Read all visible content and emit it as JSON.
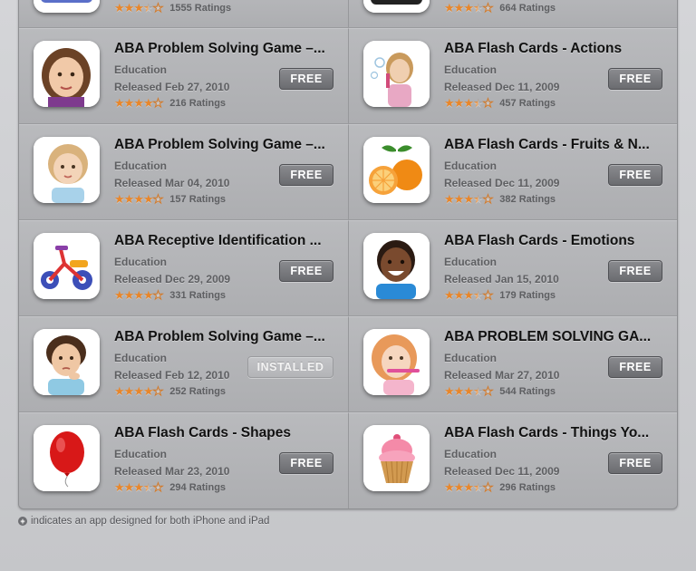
{
  "apps": [
    {
      "title": "",
      "category": "",
      "released": "",
      "ratings": "1555 Ratings",
      "stars": 3.5,
      "button": "",
      "icon": "partial-icon"
    },
    {
      "title": "",
      "category": "",
      "released": "",
      "ratings": "664 Ratings",
      "stars": 3.5,
      "button": "",
      "icon": "partial-icon"
    },
    {
      "title": "ABA Problem Solving Game –...",
      "category": "Education",
      "released": "Released Feb 27, 2010",
      "ratings": "216 Ratings",
      "stars": 4,
      "button": "FREE",
      "icon": "girl-face-icon"
    },
    {
      "title": "ABA Flash Cards - Actions",
      "category": "Education",
      "released": "Released Dec 11, 2009",
      "ratings": "457 Ratings",
      "stars": 3.5,
      "button": "FREE",
      "icon": "girl-bubbles-icon"
    },
    {
      "title": "ABA Problem Solving Game –...",
      "category": "Education",
      "released": "Released Mar 04, 2010",
      "ratings": "157 Ratings",
      "stars": 4,
      "button": "FREE",
      "icon": "girl-thinking-icon"
    },
    {
      "title": "ABA Flash Cards - Fruits & N...",
      "category": "Education",
      "released": "Released Dec 11, 2009",
      "ratings": "382 Ratings",
      "stars": 3.5,
      "button": "FREE",
      "icon": "orange-fruit-icon"
    },
    {
      "title": "ABA Receptive Identification ...",
      "category": "Education",
      "released": "Released Dec 29, 2009",
      "ratings": "331 Ratings",
      "stars": 4,
      "button": "FREE",
      "icon": "tricycle-icon"
    },
    {
      "title": "ABA Flash Cards - Emotions",
      "category": "Education",
      "released": "Released Jan 15, 2010",
      "ratings": "179 Ratings",
      "stars": 3.5,
      "button": "FREE",
      "icon": "boy-smiling-icon"
    },
    {
      "title": "ABA Problem Solving Game –...",
      "category": "Education",
      "released": "Released Feb 12, 2010",
      "ratings": "252 Ratings",
      "stars": 4,
      "button": "INSTALLED",
      "icon": "boy-thinking-icon"
    },
    {
      "title": "ABA PROBLEM SOLVING GA...",
      "category": "Education",
      "released": "Released Mar 27, 2010",
      "ratings": "544 Ratings",
      "stars": 3.5,
      "button": "FREE",
      "icon": "girl-toothbrush-icon"
    },
    {
      "title": "ABA Flash Cards - Shapes",
      "category": "Education",
      "released": "Released Mar 23, 2010",
      "ratings": "294 Ratings",
      "stars": 3.5,
      "button": "FREE",
      "icon": "balloon-icon"
    },
    {
      "title": "ABA Flash Cards - Things Yo...",
      "category": "Education",
      "released": "Released Dec 11, 2009",
      "ratings": "296 Ratings",
      "stars": 3.5,
      "button": "FREE",
      "icon": "cupcake-icon"
    }
  ],
  "footer": {
    "text": "indicates an app designed for both iPhone and iPad"
  }
}
